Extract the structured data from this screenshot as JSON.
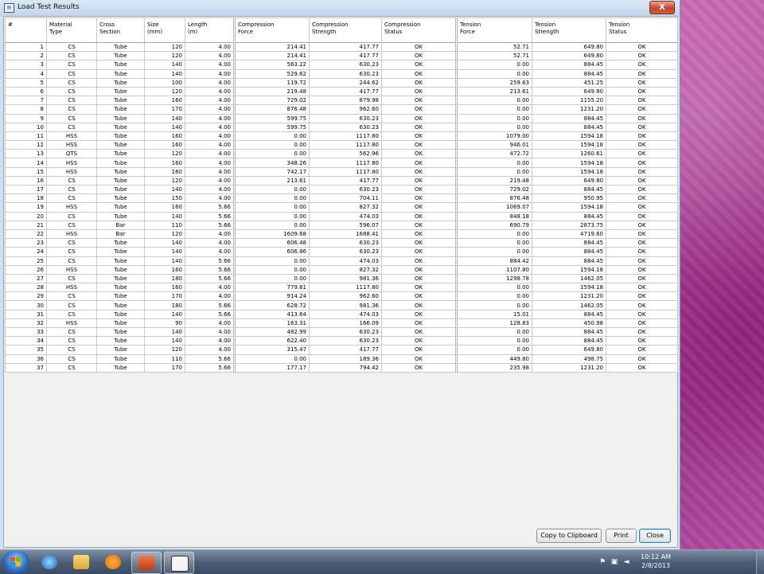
{
  "window": {
    "title": "Load Test Results",
    "close_glyph": "X"
  },
  "columns": [
    {
      "l1": "#",
      "l2": ""
    },
    {
      "l1": "Material",
      "l2": "Type"
    },
    {
      "l1": "Cross",
      "l2": "Section"
    },
    {
      "l1": "Size",
      "l2": "(mm)"
    },
    {
      "l1": "Length",
      "l2": "(m)"
    },
    {
      "l1": "Compression",
      "l2": "Force"
    },
    {
      "l1": "Compression",
      "l2": "Strength"
    },
    {
      "l1": "Compression",
      "l2": "Status"
    },
    {
      "l1": "Tension",
      "l2": "Force"
    },
    {
      "l1": "Tension",
      "l2": "Strength"
    },
    {
      "l1": "Tension",
      "l2": "Status"
    }
  ],
  "rows": [
    [
      "1",
      "CS",
      "Tube",
      "120",
      "4.00",
      "214.41",
      "417.77",
      "OK",
      "52.71",
      "649.80",
      "OK"
    ],
    [
      "2",
      "CS",
      "Tube",
      "120",
      "4.00",
      "214.41",
      "417.77",
      "OK",
      "52.71",
      "649.80",
      "OK"
    ],
    [
      "3",
      "CS",
      "Tube",
      "140",
      "4.00",
      "563.22",
      "630.23",
      "OK",
      "0.00",
      "884.45",
      "OK"
    ],
    [
      "4",
      "CS",
      "Tube",
      "140",
      "4.00",
      "529.62",
      "630.23",
      "OK",
      "0.00",
      "884.45",
      "OK"
    ],
    [
      "5",
      "CS",
      "Tube",
      "100",
      "4.00",
      "119.72",
      "244.62",
      "OK",
      "259.63",
      "451.25",
      "OK"
    ],
    [
      "6",
      "CS",
      "Tube",
      "120",
      "4.00",
      "219.48",
      "417.77",
      "OK",
      "213.61",
      "649.80",
      "OK"
    ],
    [
      "7",
      "CS",
      "Tube",
      "160",
      "4.00",
      "729.02",
      "879.98",
      "OK",
      "0.00",
      "1155.20",
      "OK"
    ],
    [
      "8",
      "CS",
      "Tube",
      "170",
      "4.00",
      "876.48",
      "962.60",
      "OK",
      "0.00",
      "1231.20",
      "OK"
    ],
    [
      "9",
      "CS",
      "Tube",
      "140",
      "4.00",
      "599.75",
      "630.23",
      "OK",
      "0.00",
      "884.45",
      "OK"
    ],
    [
      "10",
      "CS",
      "Tube",
      "140",
      "4.00",
      "599.75",
      "630.23",
      "OK",
      "0.00",
      "884.45",
      "OK"
    ],
    [
      "11",
      "HSS",
      "Tube",
      "160",
      "4.00",
      "0.00",
      "1117.80",
      "OK",
      "1079.00",
      "1594.18",
      "OK"
    ],
    [
      "12",
      "HSS",
      "Tube",
      "160",
      "4.00",
      "0.00",
      "1117.80",
      "OK",
      "946.01",
      "1594.18",
      "OK"
    ],
    [
      "13",
      "QTS",
      "Tube",
      "120",
      "4.00",
      "0.00",
      "562.96",
      "OK",
      "472.72",
      "1260.61",
      "OK"
    ],
    [
      "14",
      "HSS",
      "Tube",
      "160",
      "4.00",
      "348.26",
      "1117.80",
      "OK",
      "0.00",
      "1594.18",
      "OK"
    ],
    [
      "15",
      "HSS",
      "Tube",
      "160",
      "4.00",
      "742.17",
      "1117.80",
      "OK",
      "0.00",
      "1594.18",
      "OK"
    ],
    [
      "16",
      "CS",
      "Tube",
      "120",
      "4.00",
      "213.61",
      "417.77",
      "OK",
      "219.48",
      "649.80",
      "OK"
    ],
    [
      "17",
      "CS",
      "Tube",
      "140",
      "4.00",
      "0.00",
      "630.23",
      "OK",
      "729.02",
      "884.45",
      "OK"
    ],
    [
      "18",
      "CS",
      "Tube",
      "150",
      "4.00",
      "0.00",
      "704.11",
      "OK",
      "876.48",
      "950.95",
      "OK"
    ],
    [
      "19",
      "HSS",
      "Tube",
      "160",
      "5.66",
      "0.00",
      "827.32",
      "OK",
      "1069.07",
      "1594.18",
      "OK"
    ],
    [
      "20",
      "CS",
      "Tube",
      "140",
      "5.66",
      "0.00",
      "474.03",
      "OK",
      "848.18",
      "884.45",
      "OK"
    ],
    [
      "21",
      "CS",
      "Bar",
      "110",
      "5.66",
      "0.00",
      "596.07",
      "OK",
      "690.79",
      "2873.75",
      "OK"
    ],
    [
      "22",
      "HSS",
      "Bar",
      "120",
      "4.00",
      "1609.68",
      "1688.41",
      "OK",
      "0.00",
      "4719.60",
      "OK"
    ],
    [
      "23",
      "CS",
      "Tube",
      "140",
      "4.00",
      "606.48",
      "630.23",
      "OK",
      "0.00",
      "884.45",
      "OK"
    ],
    [
      "24",
      "CS",
      "Tube",
      "140",
      "4.00",
      "606.86",
      "630.23",
      "OK",
      "0.00",
      "884.45",
      "OK"
    ],
    [
      "25",
      "CS",
      "Tube",
      "140",
      "5.66",
      "0.00",
      "474.03",
      "OK",
      "884.42",
      "884.45",
      "OK"
    ],
    [
      "26",
      "HSS",
      "Tube",
      "160",
      "5.66",
      "0.00",
      "827.32",
      "OK",
      "1107.80",
      "1594.18",
      "OK"
    ],
    [
      "27",
      "CS",
      "Tube",
      "180",
      "5.66",
      "0.00",
      "981.36",
      "OK",
      "1298.78",
      "1462.05",
      "OK"
    ],
    [
      "28",
      "HSS",
      "Tube",
      "160",
      "4.00",
      "779.61",
      "1117.80",
      "OK",
      "0.00",
      "1594.18",
      "OK"
    ],
    [
      "29",
      "CS",
      "Tube",
      "170",
      "4.00",
      "914.24",
      "962.60",
      "OK",
      "0.00",
      "1231.20",
      "OK"
    ],
    [
      "30",
      "CS",
      "Tube",
      "180",
      "5.66",
      "628.72",
      "981.36",
      "OK",
      "0.00",
      "1462.05",
      "OK"
    ],
    [
      "31",
      "CS",
      "Tube",
      "140",
      "5.66",
      "413.64",
      "474.03",
      "OK",
      "15.01",
      "884.45",
      "OK"
    ],
    [
      "32",
      "HSS",
      "Tube",
      "90",
      "4.00",
      "163.31",
      "166.09",
      "OK",
      "128.83",
      "450.98",
      "OK"
    ],
    [
      "33",
      "CS",
      "Tube",
      "140",
      "4.00",
      "482.99",
      "630.23",
      "OK",
      "0.00",
      "884.45",
      "OK"
    ],
    [
      "34",
      "CS",
      "Tube",
      "140",
      "4.00",
      "622.40",
      "630.23",
      "OK",
      "0.00",
      "884.45",
      "OK"
    ],
    [
      "35",
      "CS",
      "Tube",
      "120",
      "4.00",
      "315.47",
      "417.77",
      "OK",
      "0.00",
      "649.80",
      "OK"
    ],
    [
      "36",
      "CS",
      "Tube",
      "110",
      "5.66",
      "0.00",
      "189.36",
      "OK",
      "449.80",
      "498.75",
      "OK"
    ],
    [
      "37",
      "CS",
      "Tube",
      "170",
      "5.66",
      "177.17",
      "794.42",
      "OK",
      "235.98",
      "1231.20",
      "OK"
    ]
  ],
  "buttons": {
    "copy": "Copy to Clipboard",
    "print": "Print",
    "close": "Close"
  },
  "taskbar": {
    "items": [
      "internet-explorer-icon",
      "file-explorer-icon",
      "media-player-icon",
      "powerpoint-icon",
      "load-test-app-icon"
    ],
    "clock_time": "10:12 AM",
    "clock_date": "2/8/2013"
  },
  "colors": {
    "accent_purple": "#a83f94",
    "close_red": "#c7432b"
  }
}
